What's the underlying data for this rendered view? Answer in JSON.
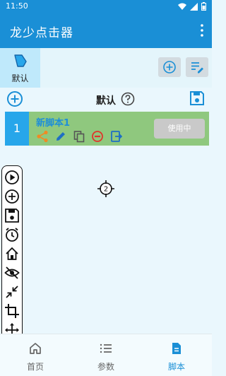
{
  "status_bar": {
    "time": "11:50"
  },
  "app_bar": {
    "title": "龙少点击器"
  },
  "groups": {
    "items": [
      {
        "label": "默认"
      }
    ]
  },
  "script_header": {
    "name": "默认"
  },
  "scripts": [
    {
      "index": "1",
      "name": "新脚本1",
      "action_label": "使用中"
    }
  ],
  "target": {
    "label": "2"
  },
  "bottom_nav": {
    "items": [
      {
        "label": "首页"
      },
      {
        "label": "参数"
      },
      {
        "label": "脚本"
      }
    ]
  },
  "colors": {
    "primary": "#1a8fd6",
    "card_bg": "#8fc87e",
    "index_bg": "#27a6ea",
    "share": "#f08a24",
    "delete": "#e0342c"
  },
  "icons": [
    "wifi-icon",
    "signal-icon",
    "battery-icon",
    "more-vert-icon",
    "group-icon",
    "add-circle-icon",
    "edit-list-icon",
    "help-icon",
    "save-icon",
    "share-icon",
    "edit-icon",
    "copy-icon",
    "remove-icon",
    "export-icon",
    "crosshair-icon",
    "play-icon",
    "add-icon",
    "timer-icon",
    "home-icon",
    "hide-icon",
    "collapse-icon",
    "crop-icon",
    "move-icon",
    "close-icon",
    "script-icon"
  ]
}
